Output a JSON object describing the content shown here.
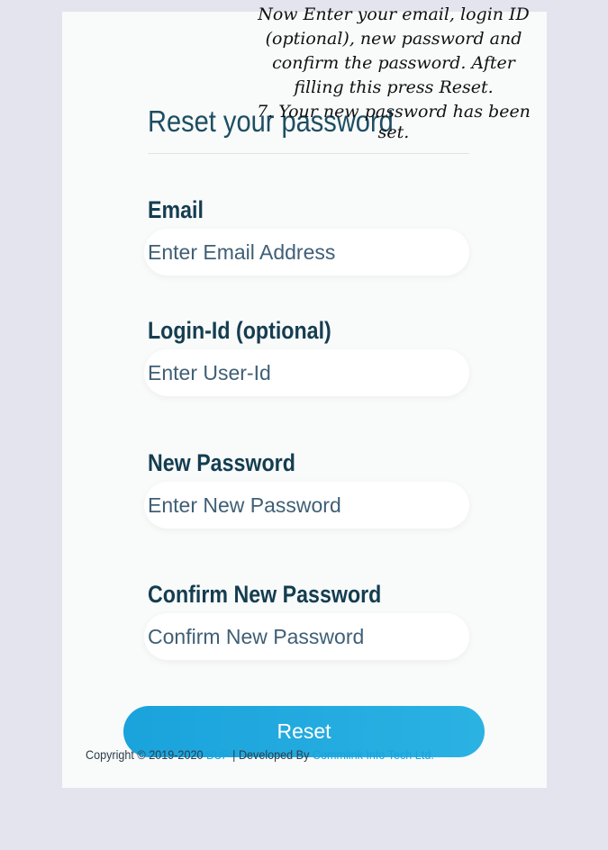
{
  "form": {
    "title": "Reset your password",
    "fields": [
      {
        "label": "Email",
        "placeholder": "Enter Email Address"
      },
      {
        "label": "Login-Id (optional)",
        "placeholder": "Enter User-Id"
      },
      {
        "label": "New Password",
        "placeholder": "Enter New Password"
      },
      {
        "label": "Confirm New Password",
        "placeholder": "Confirm New Password"
      }
    ],
    "submit_label": "Reset"
  },
  "footer": {
    "prefix": "Copyright © 2019-2020 ",
    "org_link": "BUP",
    "middle": " | Developed By ",
    "dev_link": "Commlink Info Tech Ltd."
  },
  "annotation": {
    "lines": [
      "Now Enter your email, login ID",
      "(optional), new password and",
      "confirm the password. After",
      "filling this press Reset.",
      "7. Your new password has been",
      "set."
    ]
  },
  "colors": {
    "background": "#e3e4ee",
    "card": "#f9fafa",
    "heading": "#143d50",
    "accent": "#1aa3dc"
  }
}
